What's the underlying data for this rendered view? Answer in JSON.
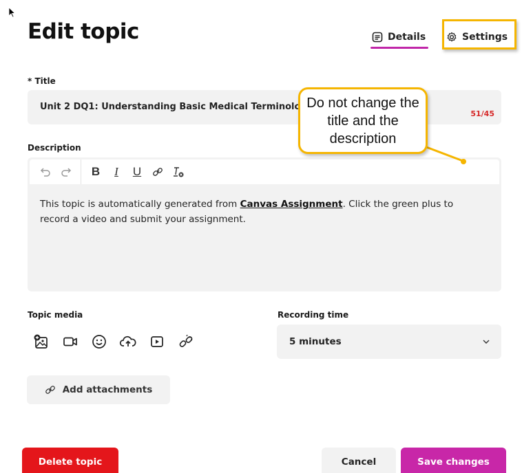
{
  "page": {
    "title": "Edit topic"
  },
  "tabs": {
    "details": "Details",
    "settings": "Settings"
  },
  "title_field": {
    "label": "* Title",
    "value": "Unit 2 DQ1: Understanding Basic Medical Terminology",
    "char_count": "51/45"
  },
  "description": {
    "label": "Description",
    "text_before": "This topic is automatically generated from ",
    "link_text": "Canvas Assignment",
    "text_after": ". Click the green plus to record a video and submit your assignment."
  },
  "toolbar": [
    "undo-icon",
    "redo-icon",
    "bold-icon",
    "italic-icon",
    "underline-icon",
    "link-icon",
    "clear-format-icon"
  ],
  "topic_media": {
    "label": "Topic media",
    "icons": [
      "add-image-icon",
      "video-icon",
      "emoji-icon",
      "upload-cloud-icon",
      "play-icon",
      "link-broken-icon"
    ]
  },
  "recording_time": {
    "label": "Recording time",
    "value": "5 minutes"
  },
  "buttons": {
    "attach": "Add attachments",
    "delete": "Delete topic",
    "cancel": "Cancel",
    "save": "Save changes"
  },
  "annotation": {
    "text": "Do not change the title and the description"
  },
  "colors": {
    "accent": "#c827a8",
    "danger": "#e4161b",
    "highlight": "#f5b500",
    "counter": "#d62828"
  }
}
